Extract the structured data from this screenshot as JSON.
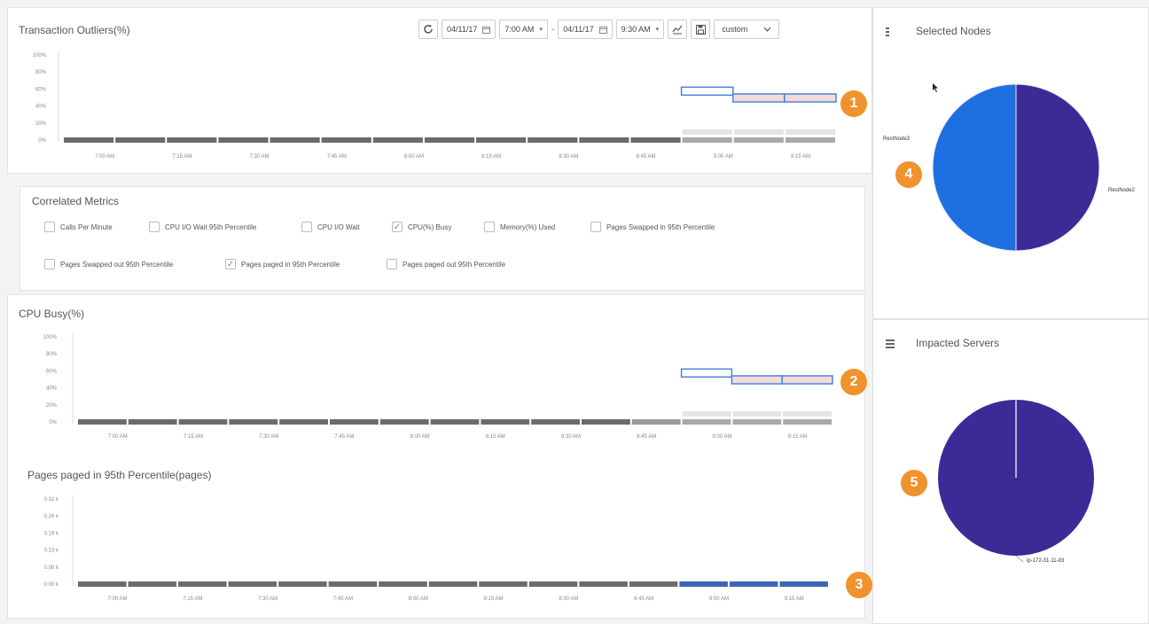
{
  "transaction_panel": {
    "title": "Transaction Outliers(%)"
  },
  "toolbar": {
    "start_date": "04/11/17",
    "start_time": "7:00 AM",
    "separator": "-",
    "end_date": "04/11/17",
    "end_time": "9:30 AM",
    "range_select": "custom"
  },
  "metrics": {
    "title": "Correlated Metrics",
    "items": [
      {
        "label": "Calls Per Minute",
        "checked": false
      },
      {
        "label": "CPU I/O Wait 95th Percentile",
        "checked": false
      },
      {
        "label": "CPU I/O Wait",
        "checked": false
      },
      {
        "label": "CPU(%) Busy",
        "checked": true
      },
      {
        "label": "Memory(%) Used",
        "checked": false
      },
      {
        "label": "Pages Swapped in 95th Percentile",
        "checked": false
      },
      {
        "label": "Pages Swapped out 95th Percentile",
        "checked": false
      },
      {
        "label": "Pages paged in 95th Percentile",
        "checked": true
      },
      {
        "label": "Pages paged out 95th Percentile",
        "checked": false
      }
    ]
  },
  "cpu_panel": {
    "title": "CPU Busy(%)"
  },
  "pages_panel": {
    "title": "Pages paged in 95th Percentile(pages)"
  },
  "selected_nodes": {
    "title": "Selected Nodes",
    "left_label": "RestNode3",
    "right_label": "RestNode2"
  },
  "impacted_servers": {
    "title": "Impacted Servers",
    "label": "ip-172-31-11-83"
  },
  "badges": [
    "1",
    "2",
    "3",
    "4",
    "5"
  ],
  "colors": {
    "pie_blue": "#1e6fe0",
    "pie_purple": "#3a2b96",
    "outlier_box": "#4a84d8",
    "badge": "#f0922e",
    "bar": "#6b6b6b"
  },
  "chart_data": [
    {
      "type": "bar",
      "title": "Transaction Outliers(%)",
      "categories": [
        "7:00 AM",
        "7:15 AM",
        "7:30 AM",
        "7:45 AM",
        "8:00 AM",
        "8:15 AM",
        "8:30 AM",
        "8:45 AM",
        "9:00 AM",
        "9:15 AM"
      ],
      "yticks": [
        "100%",
        "80%",
        "60%",
        "40%",
        "20%",
        "0%"
      ],
      "ylim": [
        0,
        100
      ],
      "values": [
        0,
        0,
        0,
        0,
        0,
        0,
        0,
        0,
        0,
        0,
        0,
        0,
        0,
        0,
        0
      ],
      "outliers": [
        {
          "from": 12,
          "to": 13,
          "value": 58
        },
        {
          "from": 13,
          "to": 14,
          "value": 50
        },
        {
          "from": 14,
          "to": 15,
          "value": 50
        }
      ]
    },
    {
      "type": "bar",
      "title": "CPU Busy(%)",
      "categories": [
        "7:00 AM",
        "7:15 AM",
        "7:30 AM",
        "7:45 AM",
        "8:00 AM",
        "8:15 AM",
        "8:30 AM",
        "8:45 AM",
        "9:00 AM",
        "9:15 AM"
      ],
      "yticks": [
        "100%",
        "80%",
        "60%",
        "40%",
        "20%",
        "0%"
      ],
      "ylim": [
        0,
        100
      ],
      "values": [
        0,
        0,
        0,
        0,
        0,
        0,
        0,
        0,
        0,
        0,
        0,
        0,
        0,
        0,
        0
      ],
      "outliers": [
        {
          "from": 12,
          "to": 13,
          "value": 58
        },
        {
          "from": 13,
          "to": 14,
          "value": 50
        },
        {
          "from": 14,
          "to": 15,
          "value": 50
        }
      ]
    },
    {
      "type": "bar",
      "title": "Pages paged in 95th Percentile(pages)",
      "categories": [
        "7:00 AM",
        "7:15 AM",
        "7:30 AM",
        "7:45 AM",
        "8:00 AM",
        "8:15 AM",
        "8:30 AM",
        "8:45 AM",
        "9:00 AM",
        "9:15 AM"
      ],
      "yticks": [
        "0.32 k",
        "0.26 k",
        "0.19 k",
        "0.13 k",
        "0.06 k",
        "0.00 k"
      ],
      "ylim": [
        0,
        0.32
      ],
      "values": [
        0,
        0,
        0,
        0,
        0,
        0,
        0,
        0,
        0,
        0,
        0,
        0,
        0,
        0,
        0
      ],
      "outliers": []
    },
    {
      "type": "pie",
      "title": "Selected Nodes",
      "labels": [
        "RestNode3",
        "RestNode2"
      ],
      "values": [
        50,
        50
      ]
    },
    {
      "type": "pie",
      "title": "Impacted Servers",
      "labels": [
        "ip-172-31-11-83"
      ],
      "values": [
        100
      ]
    }
  ]
}
